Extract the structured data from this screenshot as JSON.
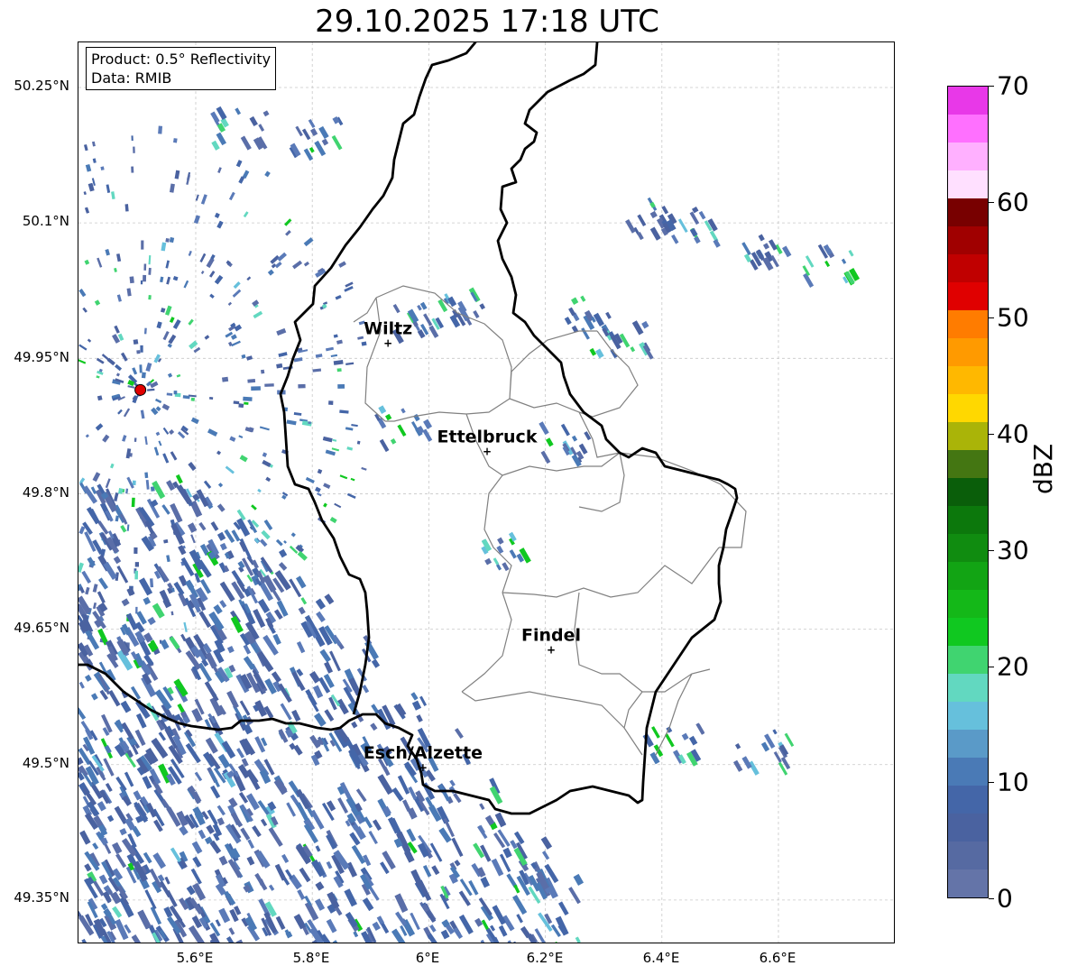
{
  "title": "29.10.2025 17:18 UTC",
  "info": {
    "product": "Product: 0.5° Reflectivity",
    "data": "Data: RMIB"
  },
  "lat_labels": [
    "50.25°N",
    "50.1°N",
    "49.95°N",
    "49.8°N",
    "49.65°N",
    "49.5°N",
    "49.35°N"
  ],
  "lon_labels": [
    "5.6°E",
    "5.8°E",
    "6°E",
    "6.2°E",
    "6.4°E",
    "6.6°E"
  ],
  "cities": [
    {
      "name": "Wiltz",
      "lon": 5.93,
      "lat": 49.967
    },
    {
      "name": "Ettelbruck",
      "lon": 6.1,
      "lat": 49.847
    },
    {
      "name": "Findel",
      "lon": 6.21,
      "lat": 49.627
    },
    {
      "name": "Esch/Alzette",
      "lon": 5.99,
      "lat": 49.497
    }
  ],
  "radar_site": {
    "lon": 5.505,
    "lat": 49.915
  },
  "colorbar": {
    "unit": "dBZ",
    "min": 0,
    "max": 70,
    "tick_labels": [
      "0",
      "10",
      "20",
      "30",
      "40",
      "50",
      "60",
      "70"
    ],
    "colors": [
      "#6474a8",
      "#566aa2",
      "#4a62a0",
      "#4466a8",
      "#4a7ab6",
      "#5a9ac8",
      "#66c0dc",
      "#62d8c0",
      "#40d470",
      "#10c820",
      "#14b818",
      "#12a414",
      "#108c10",
      "#0c780c",
      "#0a5e0a",
      "#447612",
      "#aab408",
      "#ffd800",
      "#ffb800",
      "#ff9a00",
      "#ff7c00",
      "#e00000",
      "#c00000",
      "#a00000",
      "#780000",
      "#ffe0ff",
      "#ffb0ff",
      "#ff70ff",
      "#e838e8"
    ]
  }
}
